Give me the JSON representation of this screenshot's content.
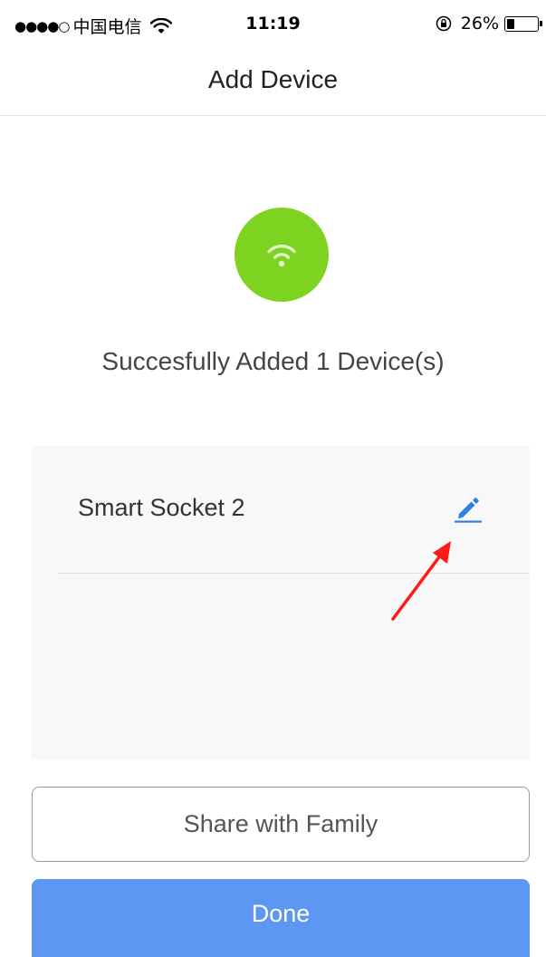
{
  "status_bar": {
    "signal": "●●●●○",
    "carrier": "中国电信",
    "time": "11:19",
    "battery_percent": "26%",
    "battery_level": 0.26,
    "icons": [
      "wifi-icon",
      "rotation-lock-icon",
      "battery-icon"
    ]
  },
  "nav": {
    "title": "Add Device"
  },
  "success": {
    "icon": "wifi-icon",
    "icon_bg_color": "#7ed321",
    "message": "Succesfully Added 1 Device(s)"
  },
  "devices": [
    {
      "name": "Smart Socket 2",
      "action_icon": "edit-pencil-icon"
    }
  ],
  "annotation": {
    "type": "arrow",
    "color": "#ff0000",
    "points_to": "edit-pencil-icon"
  },
  "buttons": {
    "share_label": "Share with Family",
    "done_label": "Done",
    "done_color": "#5b97f3"
  }
}
